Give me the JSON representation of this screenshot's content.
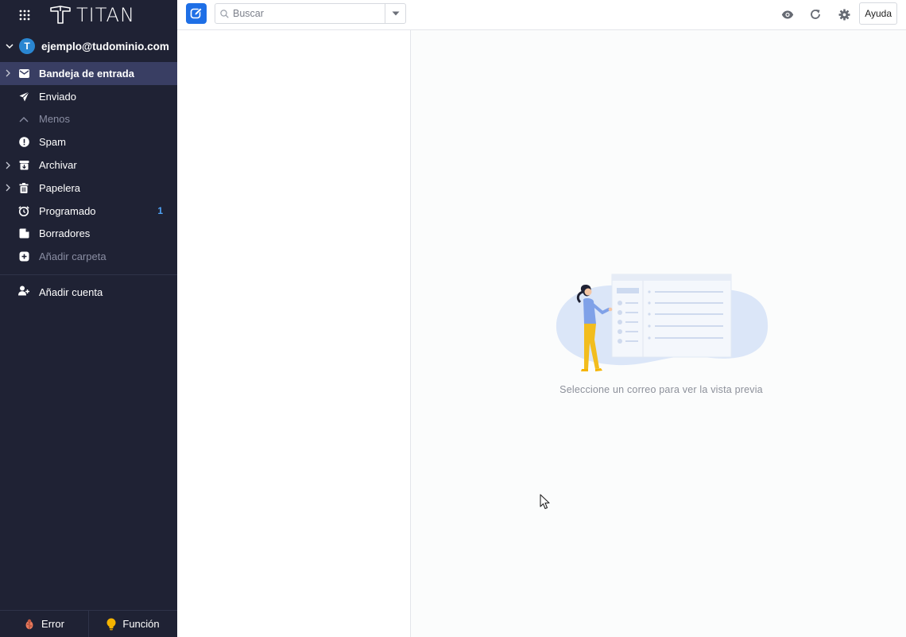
{
  "brand": {
    "name": "TITAN"
  },
  "account": {
    "avatar_letter": "T",
    "email": "ejemplo@tudominio.com",
    "avatar_color": "#2a86d1"
  },
  "folders": [
    {
      "label": "Bandeja de entrada",
      "icon": "mail-icon",
      "expandable": true,
      "active": true,
      "count": ""
    },
    {
      "label": "Enviado",
      "icon": "send-icon",
      "expandable": false,
      "active": false,
      "count": ""
    },
    {
      "label": "Menos",
      "icon": "chevron-up-icon",
      "expandable": false,
      "active": false,
      "count": ""
    },
    {
      "label": "Spam",
      "icon": "alert-icon",
      "expandable": false,
      "active": false,
      "count": ""
    },
    {
      "label": "Archivar",
      "icon": "archive-icon",
      "expandable": true,
      "active": false,
      "count": ""
    },
    {
      "label": "Papelera",
      "icon": "trash-icon",
      "expandable": true,
      "active": false,
      "count": ""
    },
    {
      "label": "Programado",
      "icon": "scheduled-icon",
      "expandable": false,
      "active": false,
      "count": "1"
    },
    {
      "label": "Borradores",
      "icon": "drafts-icon",
      "expandable": false,
      "active": false,
      "count": ""
    },
    {
      "label": "Añadir carpeta",
      "icon": "add-folder-icon",
      "expandable": false,
      "active": false,
      "count": ""
    }
  ],
  "add_account": {
    "label": "Añadir cuenta"
  },
  "bottom": {
    "error_label": "Error",
    "feature_label": "Función"
  },
  "toolbar": {
    "search_placeholder": "Buscar",
    "help_label": "Ayuda"
  },
  "preview": {
    "empty_message": "Seleccione un correo para ver la vista previa"
  },
  "colors": {
    "sidebar_bg": "#1f2234",
    "active_bg": "#393e63",
    "accent": "#1e6fe6",
    "count": "#4fa3f7"
  }
}
